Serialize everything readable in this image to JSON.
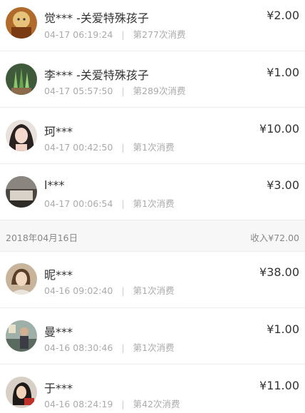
{
  "groups": [
    {
      "date": "",
      "income": "",
      "items": [
        {
          "name": "觉*** -关爱特殊孩子",
          "time": "04-17 06:19:24",
          "count": "第277次消费",
          "amount": "¥2.00"
        },
        {
          "name": "李*** -关爱特殊孩子",
          "time": "04-17 05:57:50",
          "count": "第289次消费",
          "amount": "¥1.00"
        },
        {
          "name": "珂***",
          "time": "04-17 00:42:50",
          "count": "第1次消费",
          "amount": "¥10.00"
        },
        {
          "name": "l***",
          "time": "04-17 00:06:54",
          "count": "第1次消费",
          "amount": "¥3.00"
        }
      ]
    },
    {
      "date": "2018年04月16日",
      "income": "收入¥72.00",
      "items": [
        {
          "name": "昵***",
          "time": "04-16 09:02:40",
          "count": "第1次消费",
          "amount": "¥38.00"
        },
        {
          "name": "曼***",
          "time": "04-16 08:30:46",
          "count": "第1次消费",
          "amount": "¥1.00"
        },
        {
          "name": "于***",
          "time": "04-16 08:24:19",
          "count": "第42次消费",
          "amount": "¥11.00"
        }
      ]
    }
  ]
}
